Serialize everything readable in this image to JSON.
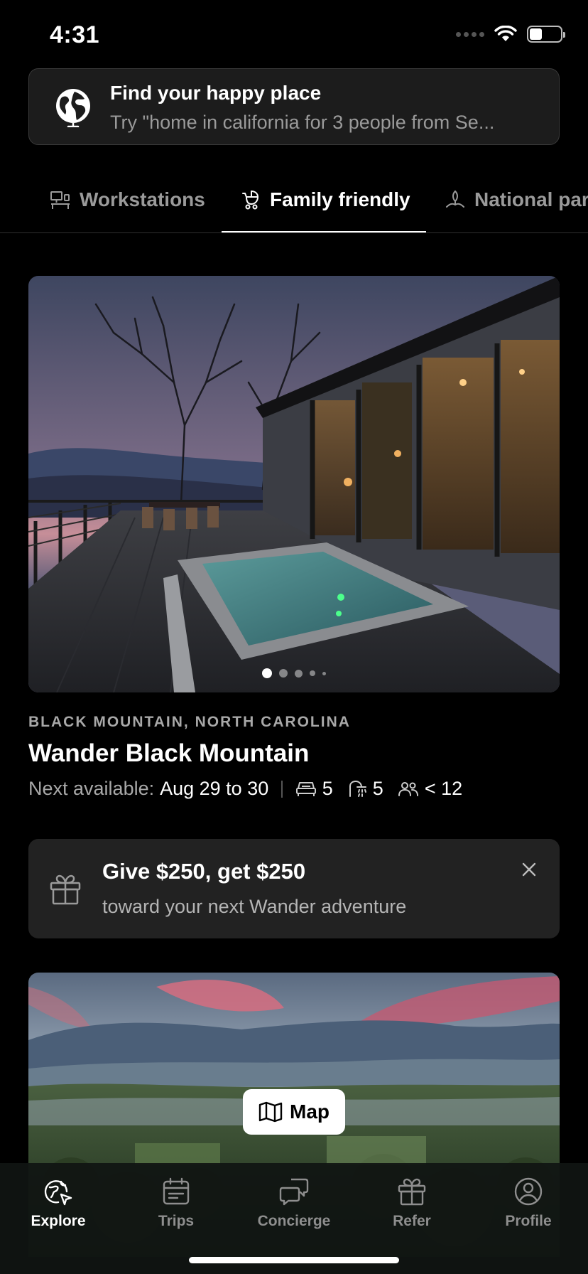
{
  "status_bar": {
    "time": "4:31"
  },
  "search": {
    "title": "Find your happy place",
    "placeholder": "Try \"home in california for 3 people from Se..."
  },
  "category_tabs": [
    {
      "label": "Workstations",
      "icon": "desk-icon",
      "active": false
    },
    {
      "label": "Family friendly",
      "icon": "stroller-icon",
      "active": true
    },
    {
      "label": "National parks",
      "icon": "park-icon",
      "active": false
    }
  ],
  "listing": {
    "location": "BLACK MOUNTAIN, NORTH CAROLINA",
    "name": "Wander Black Mountain",
    "next_available_prefix": "Next available:",
    "next_available_dates": "Aug 29 to 30",
    "bedrooms": "5",
    "bathrooms": "5",
    "guests": "< 12",
    "photo_count_dots": 5,
    "active_photo_index": 0
  },
  "promo": {
    "title": "Give $250, get $250",
    "subtitle": "toward your next Wander adventure"
  },
  "map_button": {
    "label": "Map"
  },
  "bottom_nav": [
    {
      "label": "Explore",
      "icon": "explore-icon",
      "active": true
    },
    {
      "label": "Trips",
      "icon": "calendar-icon",
      "active": false
    },
    {
      "label": "Concierge",
      "icon": "chat-bubbles-icon",
      "active": false
    },
    {
      "label": "Refer",
      "icon": "gift-icon",
      "active": false
    },
    {
      "label": "Profile",
      "icon": "profile-icon",
      "active": false
    }
  ],
  "colors": {
    "background": "#000000",
    "card": "#1c1c1c",
    "promo_card": "#222222",
    "muted_text": "#9a9a9a",
    "active_text": "#ffffff"
  }
}
